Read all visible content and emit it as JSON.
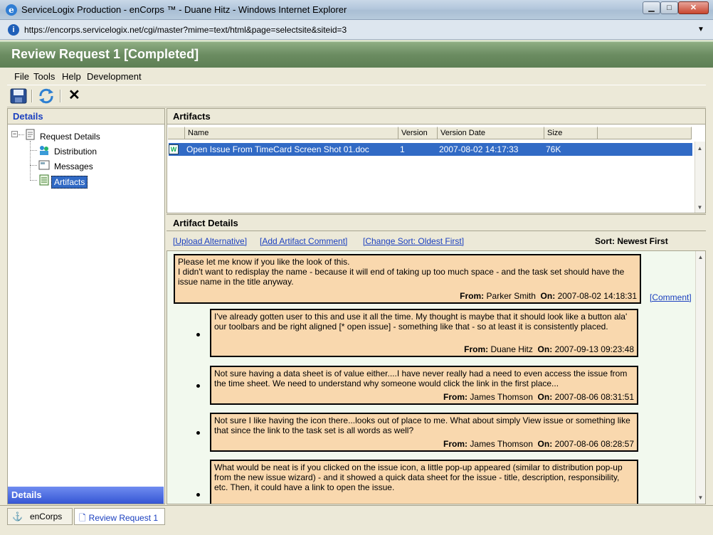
{
  "window": {
    "title": "ServiceLogix Production - enCorps ™ - Duane Hitz - Windows Internet Explorer",
    "url": "https://encorps.servicelogix.net/cgi/master?mime=text/html&page=selectsite&siteid=3",
    "ie_icon": "e",
    "info_icon": "i",
    "min_glyph": "▁",
    "max_glyph": "□",
    "close_glyph": "✕"
  },
  "app": {
    "title": "Review Request 1 [Completed]"
  },
  "menu": {
    "file": "File",
    "tools": "Tools",
    "help": "Help",
    "development": "Development"
  },
  "toolbar": {
    "close_glyph": "✕"
  },
  "left": {
    "header": "Details",
    "tree": {
      "root": "Request Details",
      "items": [
        "Distribution",
        "Messages",
        "Artifacts"
      ]
    },
    "footer": "Details"
  },
  "artifacts": {
    "title": "Artifacts",
    "columns": [
      "Name",
      "Version",
      "Version Date",
      "Size"
    ],
    "rows": [
      {
        "name": "Open Issue From TimeCard Screen Shot 01.doc",
        "version": "1",
        "date": "2007-08-02 14:17:33",
        "size": "76K"
      }
    ]
  },
  "details": {
    "title": "Artifact Details",
    "actions": [
      "[Upload Alternative]",
      "[Add Artifact Comment]",
      "[Change Sort: Oldest First]"
    ],
    "sort": "Sort: Newest First",
    "comment_link": "[Comment]",
    "from_label": "From:",
    "on_label": "On:",
    "comments": [
      {
        "text": "Please let me know if you like the look of this.\nI didn't want to redisplay the name - because it will end of taking up too much space - and the task set should have the issue name in the title anyway.",
        "from": "Parker Smith",
        "on": "2007-08-02 14:18:31"
      },
      {
        "text": "I've already gotten user to this and use it all the time.  My thought is maybe that it should look like a button ala' our toolbars and be right aligned [* open issue] - something like that - so at least it is consistently placed.",
        "from": "Duane Hitz",
        "on": "2007-09-13 09:23:48"
      },
      {
        "text": "Not sure having a data sheet is of value either....I have never really had a need to even access the issue from the time sheet.  We need to understand why someone would click the link in the first place...",
        "from": "James Thomson",
        "on": "2007-08-06 08:31:51"
      },
      {
        "text": "Not sure I like having the icon there...looks out of place to me.  What about simply View issue or something like that since the link to the task set is all words as well?",
        "from": "James Thomson",
        "on": "2007-08-06 08:28:57"
      },
      {
        "text": "What would be neat is if you clicked on the issue icon, a little pop-up appeared (similar to distribution pop-up from the new issue wizard) - and it showed a quick data sheet for the issue - title, description, responsibility, etc.  Then, it could have a link to open the issue.",
        "from": "",
        "on": ""
      }
    ]
  },
  "taskbar": {
    "encorps": "enCorps",
    "review": "Review Request 1"
  }
}
